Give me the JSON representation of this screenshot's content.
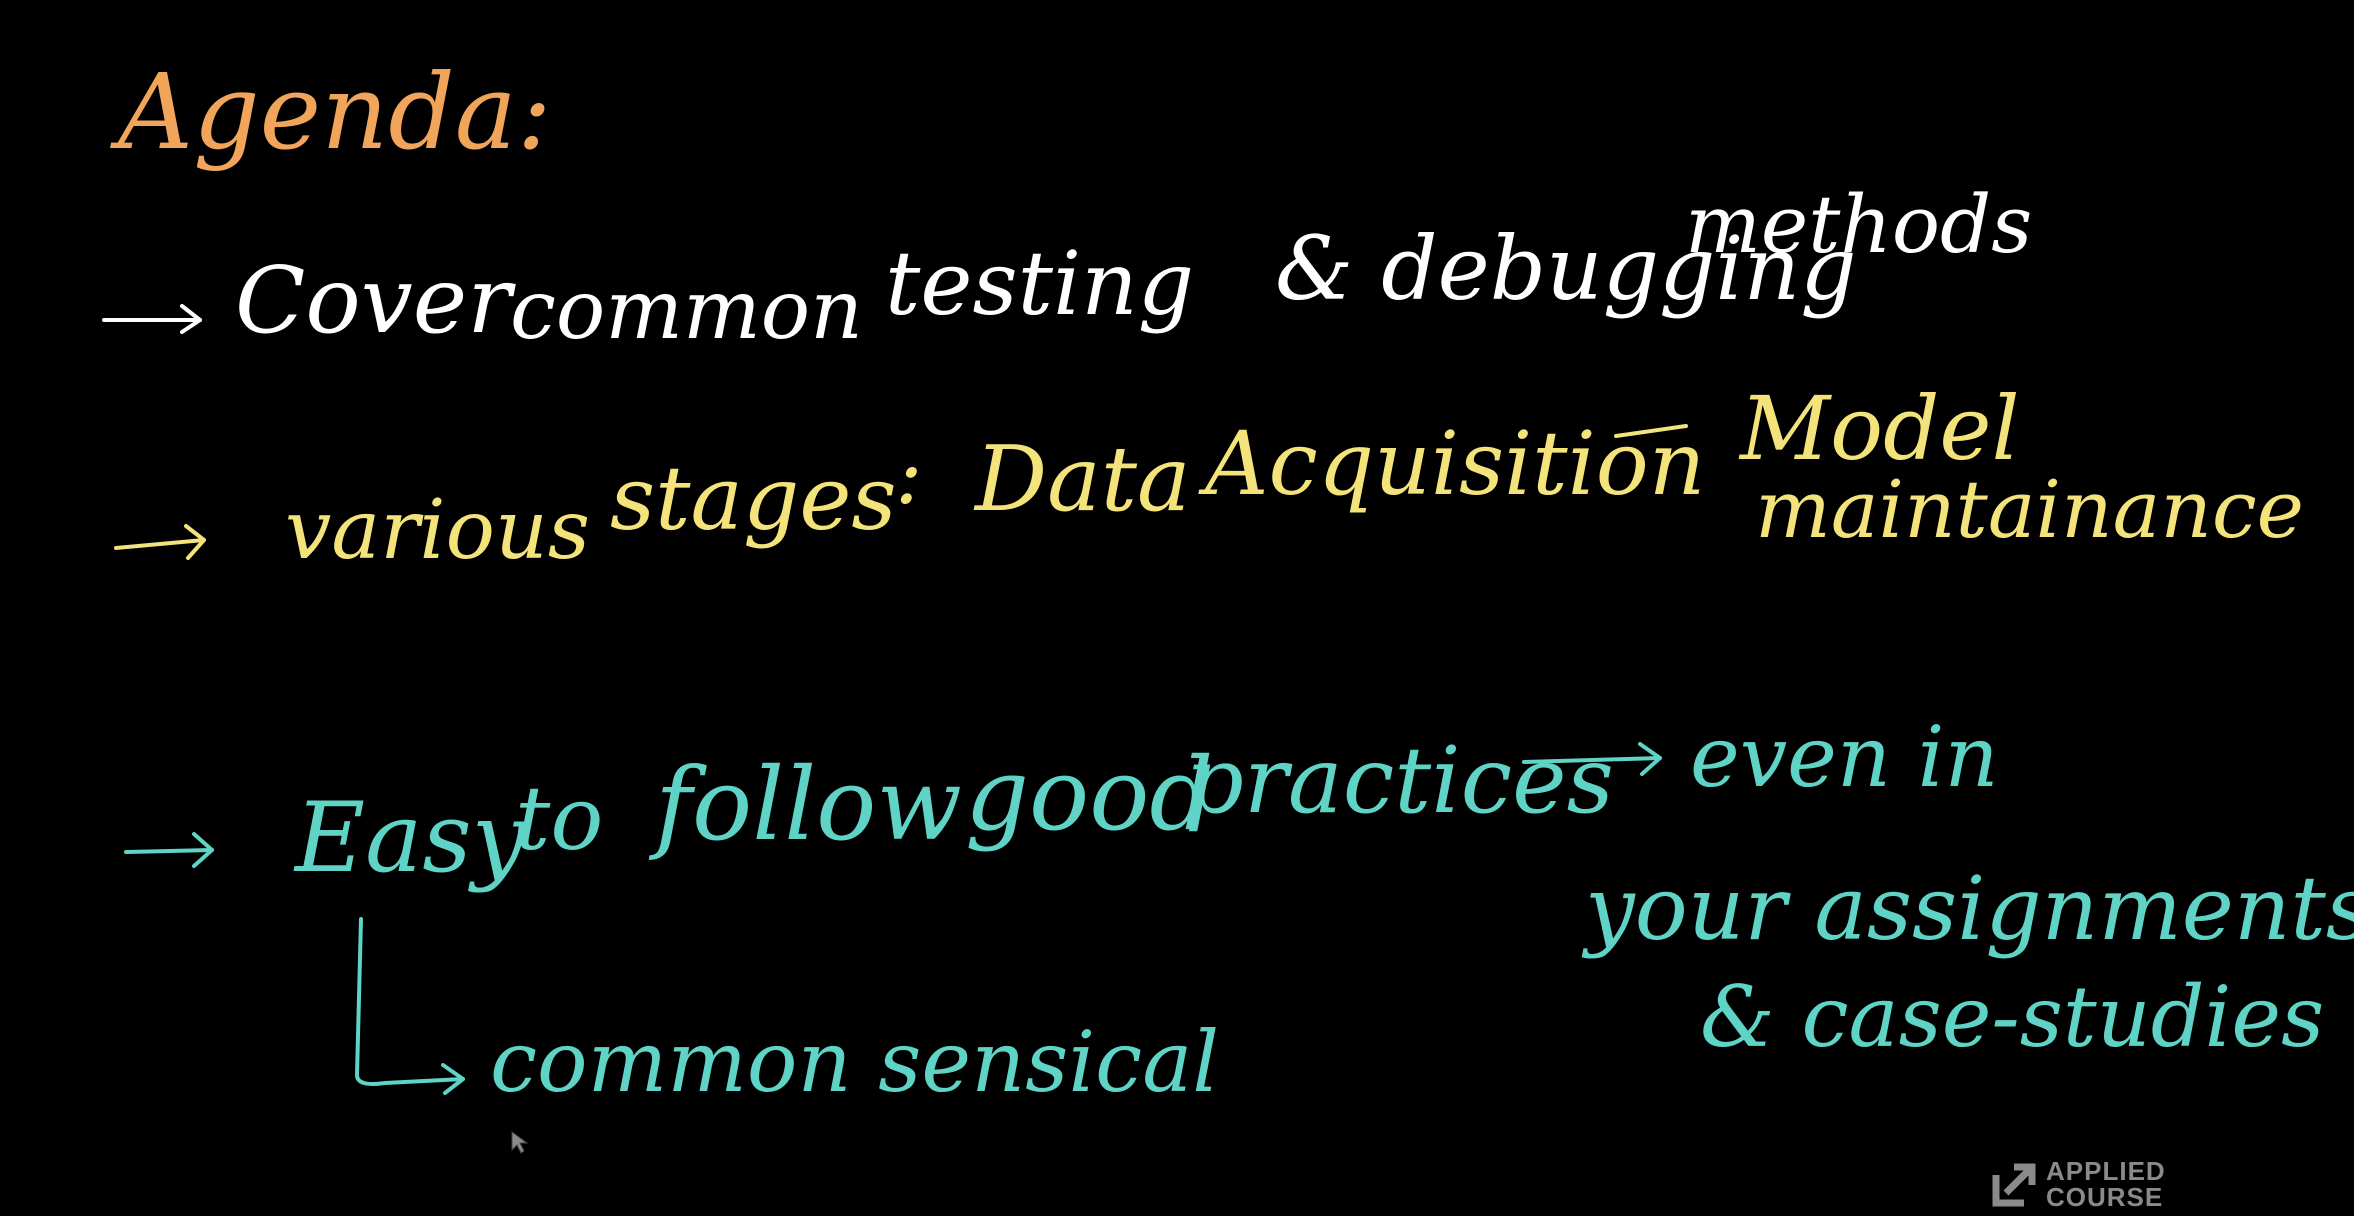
{
  "colors": {
    "background": "#000000",
    "title": "#f1a55a",
    "line1": "#ffffff",
    "line2": "#f3e37a",
    "line3": "#5fd3c6",
    "watermark": "#8a8a8a"
  },
  "agenda": {
    "title": "Agenda:"
  },
  "line1": {
    "part_a": "Cover",
    "part_b": "common",
    "part_c": "testing",
    "part_d": "& debugging",
    "part_e": "methods"
  },
  "line2": {
    "part_a": "various",
    "part_b": "stages",
    "part_c": ":",
    "part_d": "Data",
    "part_e": "Acquisition",
    "part_f": "Model",
    "part_g": "maintainance"
  },
  "line3": {
    "part_a": "Easy",
    "part_b": "to",
    "part_c": "follow",
    "part_d": "good",
    "part_e": "practices",
    "part_f": "even in",
    "part_g": "your assignments",
    "part_h": "& case-studies",
    "sub": "common sensical"
  },
  "watermark": {
    "line1": "APPLIED",
    "line2": "COURSE",
    "icon": "applied-course-logo-icon"
  }
}
